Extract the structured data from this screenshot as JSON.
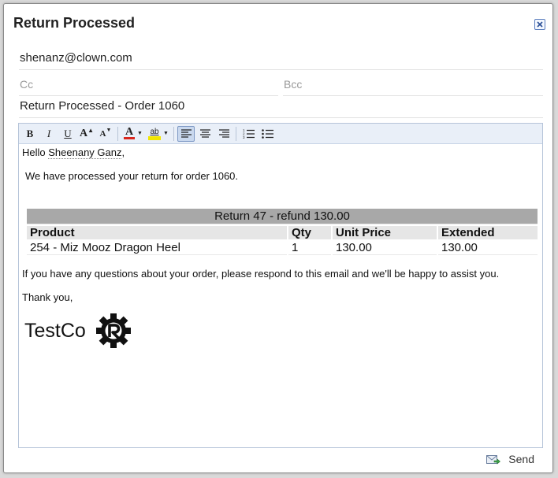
{
  "dialog": {
    "title": "Return Processed"
  },
  "fields": {
    "to_value": "shenanz@clown.com",
    "cc_placeholder": "Cc",
    "bcc_placeholder": "Bcc",
    "subject_value": "Return Processed - Order 1060"
  },
  "toolbar": {
    "bold": "B",
    "italic": "I",
    "underline": "U",
    "increase_font": "A",
    "decrease_font": "A",
    "font_color": "A",
    "highlight": "ab",
    "font_color_hex": "#d9261c",
    "highlight_hex": "#f2e600"
  },
  "message": {
    "greeting_prefix": "Hello ",
    "customer_name": "Sheenany Ganz",
    "greeting_suffix": ",",
    "body": "We have processed your return for order 1060.",
    "table": {
      "title": "Return 47 - refund 130.00",
      "headers": [
        "Product",
        "Qty",
        "Unit Price",
        "Extended"
      ],
      "rows": [
        [
          "254 - Miz Mooz Dragon Heel",
          "1",
          "130.00",
          "130.00"
        ]
      ]
    },
    "questions": "If you have any questions about your order, please respond to this email and we'll be happy to assist you.",
    "thanks": "Thank you,",
    "signature": "TestCo"
  },
  "footer": {
    "send_label": "Send"
  }
}
